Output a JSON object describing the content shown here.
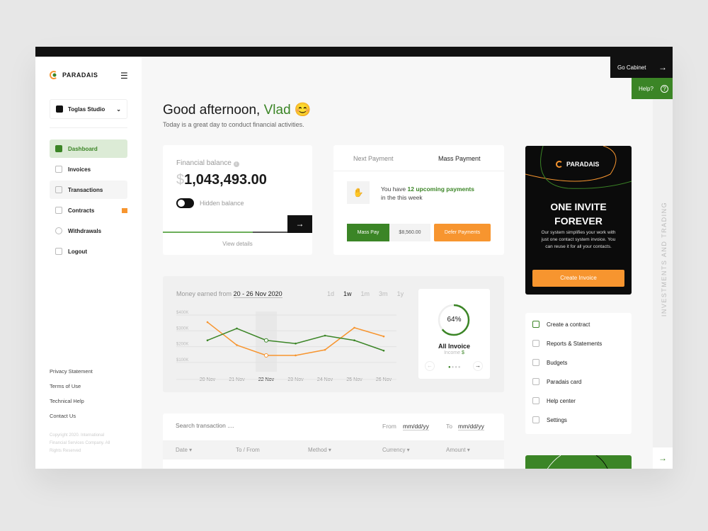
{
  "brand": "PARADAIS",
  "workspace": "Toglas Studio",
  "sidebar": {
    "items": [
      {
        "label": "Dashboard"
      },
      {
        "label": "Invoices"
      },
      {
        "label": "Transactions"
      },
      {
        "label": "Contracts"
      },
      {
        "label": "Withdrawals"
      },
      {
        "label": "Logout"
      }
    ],
    "footer": [
      "Privacy Statement",
      "Terms of Use",
      "Technical Help",
      "Contact Us"
    ],
    "copyright": "Copyright 2020. International Financial Services Company. All Rights Reserved"
  },
  "header": {
    "greeting": "Good afternoon,",
    "name": "Vlad",
    "emoji": "😊",
    "subtitle": "Today is a great day to conduct financial activities."
  },
  "top_actions": {
    "cabinet": "Go Cabinet",
    "help": "Help?"
  },
  "balance": {
    "label": "Financial balance",
    "currency": "$",
    "amount": "1,043,493.00",
    "toggle_label": "Hidden balance",
    "toggle_on": false,
    "view_details": "View details",
    "progress_percent": 72
  },
  "payment": {
    "tabs": [
      "Next Payment",
      "Mass Payment"
    ],
    "active_tab": "Mass Payment",
    "text_pre": "You have",
    "highlight": "12 upcoming payments",
    "text_post": "in the this week",
    "mass_pay": "Mass Pay",
    "amount": "$8,560.00",
    "defer": "Defer Payments"
  },
  "chart": {
    "title_pre": "Money earned from",
    "range": "20 - 26 Nov 2020",
    "periods": [
      "1d",
      "1w",
      "1m",
      "3m",
      "1y"
    ],
    "active_period": "1w"
  },
  "chart_data": {
    "type": "line",
    "x": [
      "20 Nov",
      "21 Nov",
      "22 Nov",
      "23 Nov",
      "24 Nov",
      "25 Nov",
      "26 Nov"
    ],
    "highlight_x": "22 Nov",
    "yticks": [
      "$400K",
      "$300K",
      "$200K",
      "$100K"
    ],
    "ylim": [
      100000,
      400000
    ],
    "grid": true,
    "series": [
      {
        "color": "#f7952f",
        "values": [
          355000,
          210000,
          145000,
          145000,
          180000,
          320000,
          265000
        ]
      },
      {
        "color": "#3b8526",
        "values": [
          240000,
          315000,
          240000,
          220000,
          270000,
          240000,
          175000
        ]
      }
    ]
  },
  "invoice_widget": {
    "percent": 64,
    "percent_label": "64%",
    "title": "All Invoice",
    "subtitle": "Income",
    "currency": "$"
  },
  "transactions": {
    "search_placeholder": "Search transaction ....",
    "from": "From",
    "to": "To",
    "date_placeholder": "mm/dd/yy",
    "columns": [
      "Date ▾",
      "To / From",
      "Method ▾",
      "Currency ▾",
      "Amount ▾"
    ]
  },
  "promo": {
    "brand": "PARADAIS",
    "title1": "ONE INVITE",
    "title2": "FOREVER",
    "body": "Our system simplifies your work with just one contact system invoice. You can reuse it for all your contacts.",
    "cta": "Create Invoice"
  },
  "quick_links": [
    "Create a contract",
    "Reports & Statements",
    "Budgets",
    "Paradais card",
    "Help center",
    "Settings"
  ],
  "rail_text": "INVESTMENTS AND TRADING",
  "colors": {
    "green": "#3b8526",
    "orange": "#f7952f",
    "black": "#111111"
  }
}
